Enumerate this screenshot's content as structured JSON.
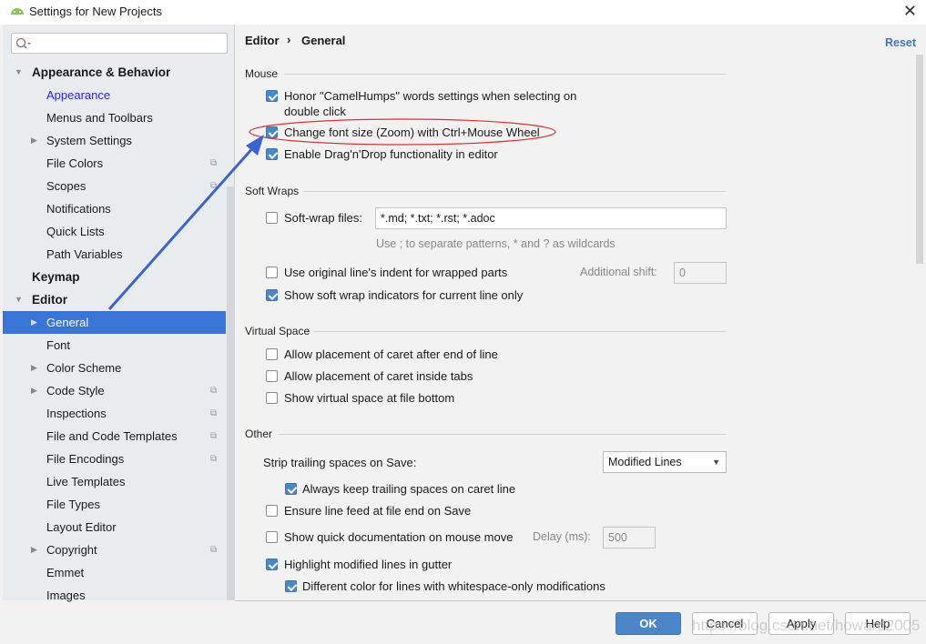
{
  "window": {
    "title": "Settings for New Projects",
    "close_icon": "close-icon",
    "app_icon": "android-icon"
  },
  "sidebar": {
    "search_placeholder": "",
    "items": [
      {
        "label": "Appearance & Behavior",
        "level": 0,
        "bold": true,
        "expanded": true
      },
      {
        "label": "Appearance",
        "level": 1,
        "link": true
      },
      {
        "label": "Menus and Toolbars",
        "level": 1
      },
      {
        "label": "System Settings",
        "level": 1,
        "collapsed": true
      },
      {
        "label": "File Colors",
        "level": 1,
        "copy": true
      },
      {
        "label": "Scopes",
        "level": 1,
        "copy": true
      },
      {
        "label": "Notifications",
        "level": 1
      },
      {
        "label": "Quick Lists",
        "level": 1
      },
      {
        "label": "Path Variables",
        "level": 1
      },
      {
        "label": "Keymap",
        "level": 0,
        "bold": true
      },
      {
        "label": "Editor",
        "level": 0,
        "bold": true,
        "expanded": true
      },
      {
        "label": "General",
        "level": 1,
        "collapsed": true,
        "selected": true
      },
      {
        "label": "Font",
        "level": 1
      },
      {
        "label": "Color Scheme",
        "level": 1,
        "collapsed": true
      },
      {
        "label": "Code Style",
        "level": 1,
        "collapsed": true,
        "copy": true
      },
      {
        "label": "Inspections",
        "level": 1,
        "copy": true
      },
      {
        "label": "File and Code Templates",
        "level": 1,
        "copy": true
      },
      {
        "label": "File Encodings",
        "level": 1,
        "copy": true
      },
      {
        "label": "Live Templates",
        "level": 1
      },
      {
        "label": "File Types",
        "level": 1
      },
      {
        "label": "Layout Editor",
        "level": 1
      },
      {
        "label": "Copyright",
        "level": 1,
        "collapsed": true,
        "copy": true
      },
      {
        "label": "Emmet",
        "level": 1
      },
      {
        "label": "Images",
        "level": 1
      }
    ]
  },
  "header": {
    "breadcrumb": [
      "Editor",
      "General"
    ],
    "separator": "›",
    "reset": "Reset"
  },
  "mouse": {
    "title": "Mouse",
    "honor_line1": "Honor \"CamelHumps\" words settings when selecting on",
    "honor_line2": "double click",
    "honor_checked": true,
    "zoom": "Change font size (Zoom) with Ctrl+Mouse Wheel",
    "zoom_checked": true,
    "dnd": "Enable Drag'n'Drop functionality in editor",
    "dnd_checked": true
  },
  "soft_wraps": {
    "title": "Soft Wraps",
    "files_label": "Soft-wrap files:",
    "files_checked": false,
    "files_value": "*.md; *.txt; *.rst; *.adoc",
    "hint": "Use ; to separate patterns, * and ? as wildcards",
    "indent": "Use original line's indent for wrapped parts",
    "indent_checked": false,
    "shift_label": "Additional shift:",
    "shift_value": "0",
    "indicators": "Show soft wrap indicators for current line only",
    "indicators_checked": true
  },
  "virtual_space": {
    "title": "Virtual Space",
    "after_end": "Allow placement of caret after end of line",
    "inside_tabs": "Allow placement of caret inside tabs",
    "file_bottom": "Show virtual space at file bottom"
  },
  "other": {
    "title": "Other",
    "strip_label": "Strip trailing spaces on Save:",
    "strip_value": "Modified Lines",
    "keep_trailing": "Always keep trailing spaces on caret line",
    "keep_checked": true,
    "line_feed": "Ensure line feed at file end on Save",
    "quick_doc": "Show quick documentation on mouse move",
    "delay_label": "Delay (ms):",
    "delay_value": "500",
    "highlight": "Highlight modified lines in gutter",
    "highlight_checked": true,
    "whitespace": "Different color for lines with whitespace-only modifications",
    "whitespace_checked": true
  },
  "buttons": {
    "ok": "OK",
    "cancel": "Cancel",
    "apply": "Apply",
    "help": "Help"
  },
  "watermark": "https://blog.csdn.net/howard2005",
  "annotation": {
    "color": "#e03030",
    "arrow_color": "#3a63d8"
  }
}
